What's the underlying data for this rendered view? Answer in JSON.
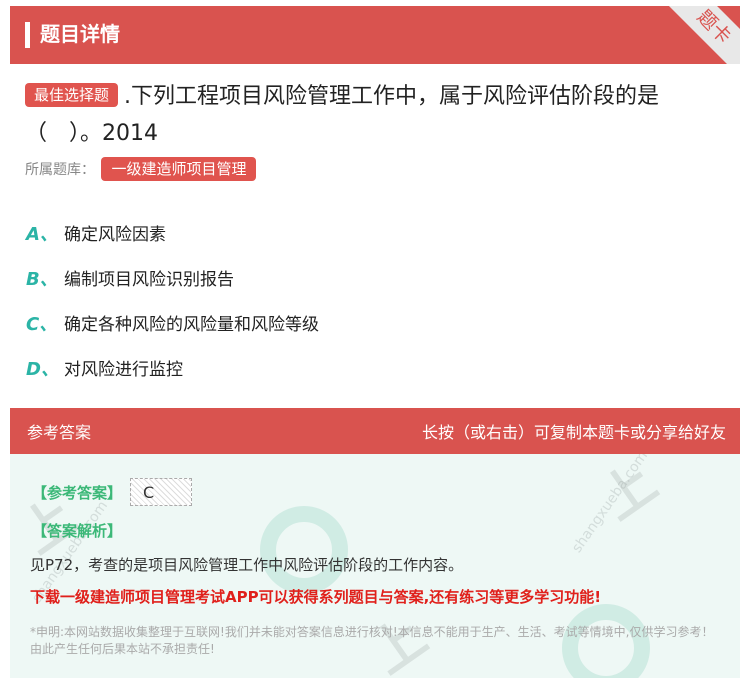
{
  "header": {
    "title": "题目详情",
    "ribbon_text": "题卡"
  },
  "question": {
    "tag": "最佳选择题",
    "text": ".下列工程项目风险管理工作中，属于风险评估阶段的是（　）。2014",
    "library_label": "所属题库：",
    "library_value": "一级建造师项目管理"
  },
  "options": [
    {
      "letter": "A、",
      "text": "确定风险因素"
    },
    {
      "letter": "B、",
      "text": "编制项目风险识别报告"
    },
    {
      "letter": "C、",
      "text": "确定各种风险的风险量和风险等级"
    },
    {
      "letter": "D、",
      "text": "对风险进行监控"
    }
  ],
  "answer_section": {
    "title": "参考答案",
    "hint": "长按（或右击）可复制本题卡或分享给好友",
    "ref_label": "【参考答案】",
    "ref_value": "C",
    "analysis_label": "【答案解析】",
    "analysis_text": "见P72，考查的是项目风险管理工作中风险评估阶段的工作内容。",
    "promo": "下载一级建造师项目管理考试APP可以获得系列题目与答案,还有练习等更多学习功能!",
    "disclaimer": "*申明:本网站数据收集整理于互联网!我们并未能对答案信息进行核对!本信息不能用于生产、生活、考试等情境中,仅供学习参考！由此产生任何后果本站不承担责任!"
  },
  "colors": {
    "brand_red": "#d9534f",
    "option_teal": "#2bb4a6",
    "answer_green": "#3cb878",
    "promo_red": "#e0201b"
  }
}
